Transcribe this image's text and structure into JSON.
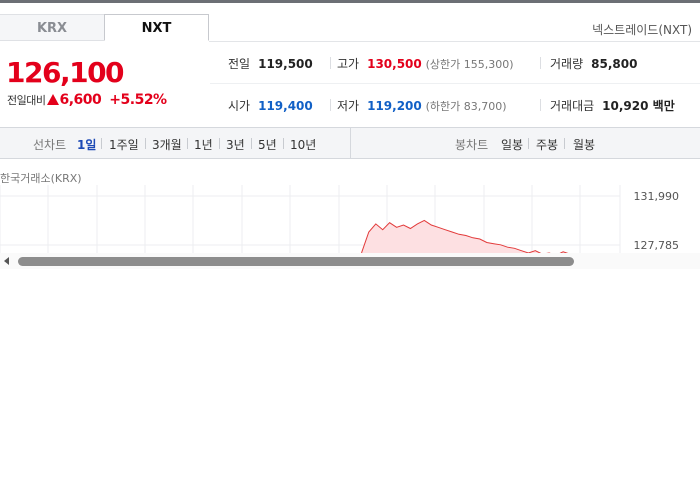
{
  "tabs": [
    {
      "label": "KRX",
      "active": false
    },
    {
      "label": "NXT",
      "active": true
    }
  ],
  "exchange_label": "넥스트레이드(NXT)",
  "price": {
    "current": "126,100",
    "change_label": "전일대비",
    "change_direction": "up",
    "change_amount": "6,600",
    "change_rate": "+5.52%"
  },
  "info": {
    "prev_close": {
      "label": "전일",
      "value": "119,500"
    },
    "high": {
      "label": "고가",
      "value": "130,500",
      "sub": "(상한가 155,300)"
    },
    "volume": {
      "label": "거래량",
      "value": "85,800"
    },
    "open": {
      "label": "시가",
      "value": "119,400"
    },
    "low": {
      "label": "저가",
      "value": "119,200",
      "sub": "(하한가 83,700)"
    },
    "trade_value": {
      "label": "거래대금",
      "value": "10,920 백만"
    }
  },
  "line_chart_periods": {
    "title": "선차트",
    "items": [
      "1일",
      "1주일",
      "3개월",
      "1년",
      "3년",
      "5년",
      "10년"
    ],
    "active": "1일"
  },
  "candle_chart_periods": {
    "title": "봉차트",
    "items": [
      "일봉",
      "주봉",
      "월봉"
    ]
  },
  "chart_source": "한국거래소(KRX)",
  "chart_data": {
    "type": "area",
    "y_ticks": [
      "131,990",
      "127,785"
    ],
    "ylim": [
      123580,
      131990
    ],
    "values": [
      123400,
      124800,
      127200,
      128900,
      129600,
      129100,
      129700,
      129300,
      129500,
      129200,
      129600,
      129900,
      129500,
      129300,
      129100,
      128900,
      128700,
      128600,
      128400,
      128300,
      128000,
      127900,
      127800,
      127600,
      127500,
      127300,
      127100,
      127300,
      127000,
      127100,
      126900,
      127200,
      127000
    ],
    "x_range_index": [
      0,
      42
    ],
    "colors": {
      "line": "#e23a3a",
      "fill": "#fde0e2"
    }
  },
  "colors": {
    "up": "#e3001b",
    "down": "#1160c6",
    "active_period": "#1c49b5"
  }
}
